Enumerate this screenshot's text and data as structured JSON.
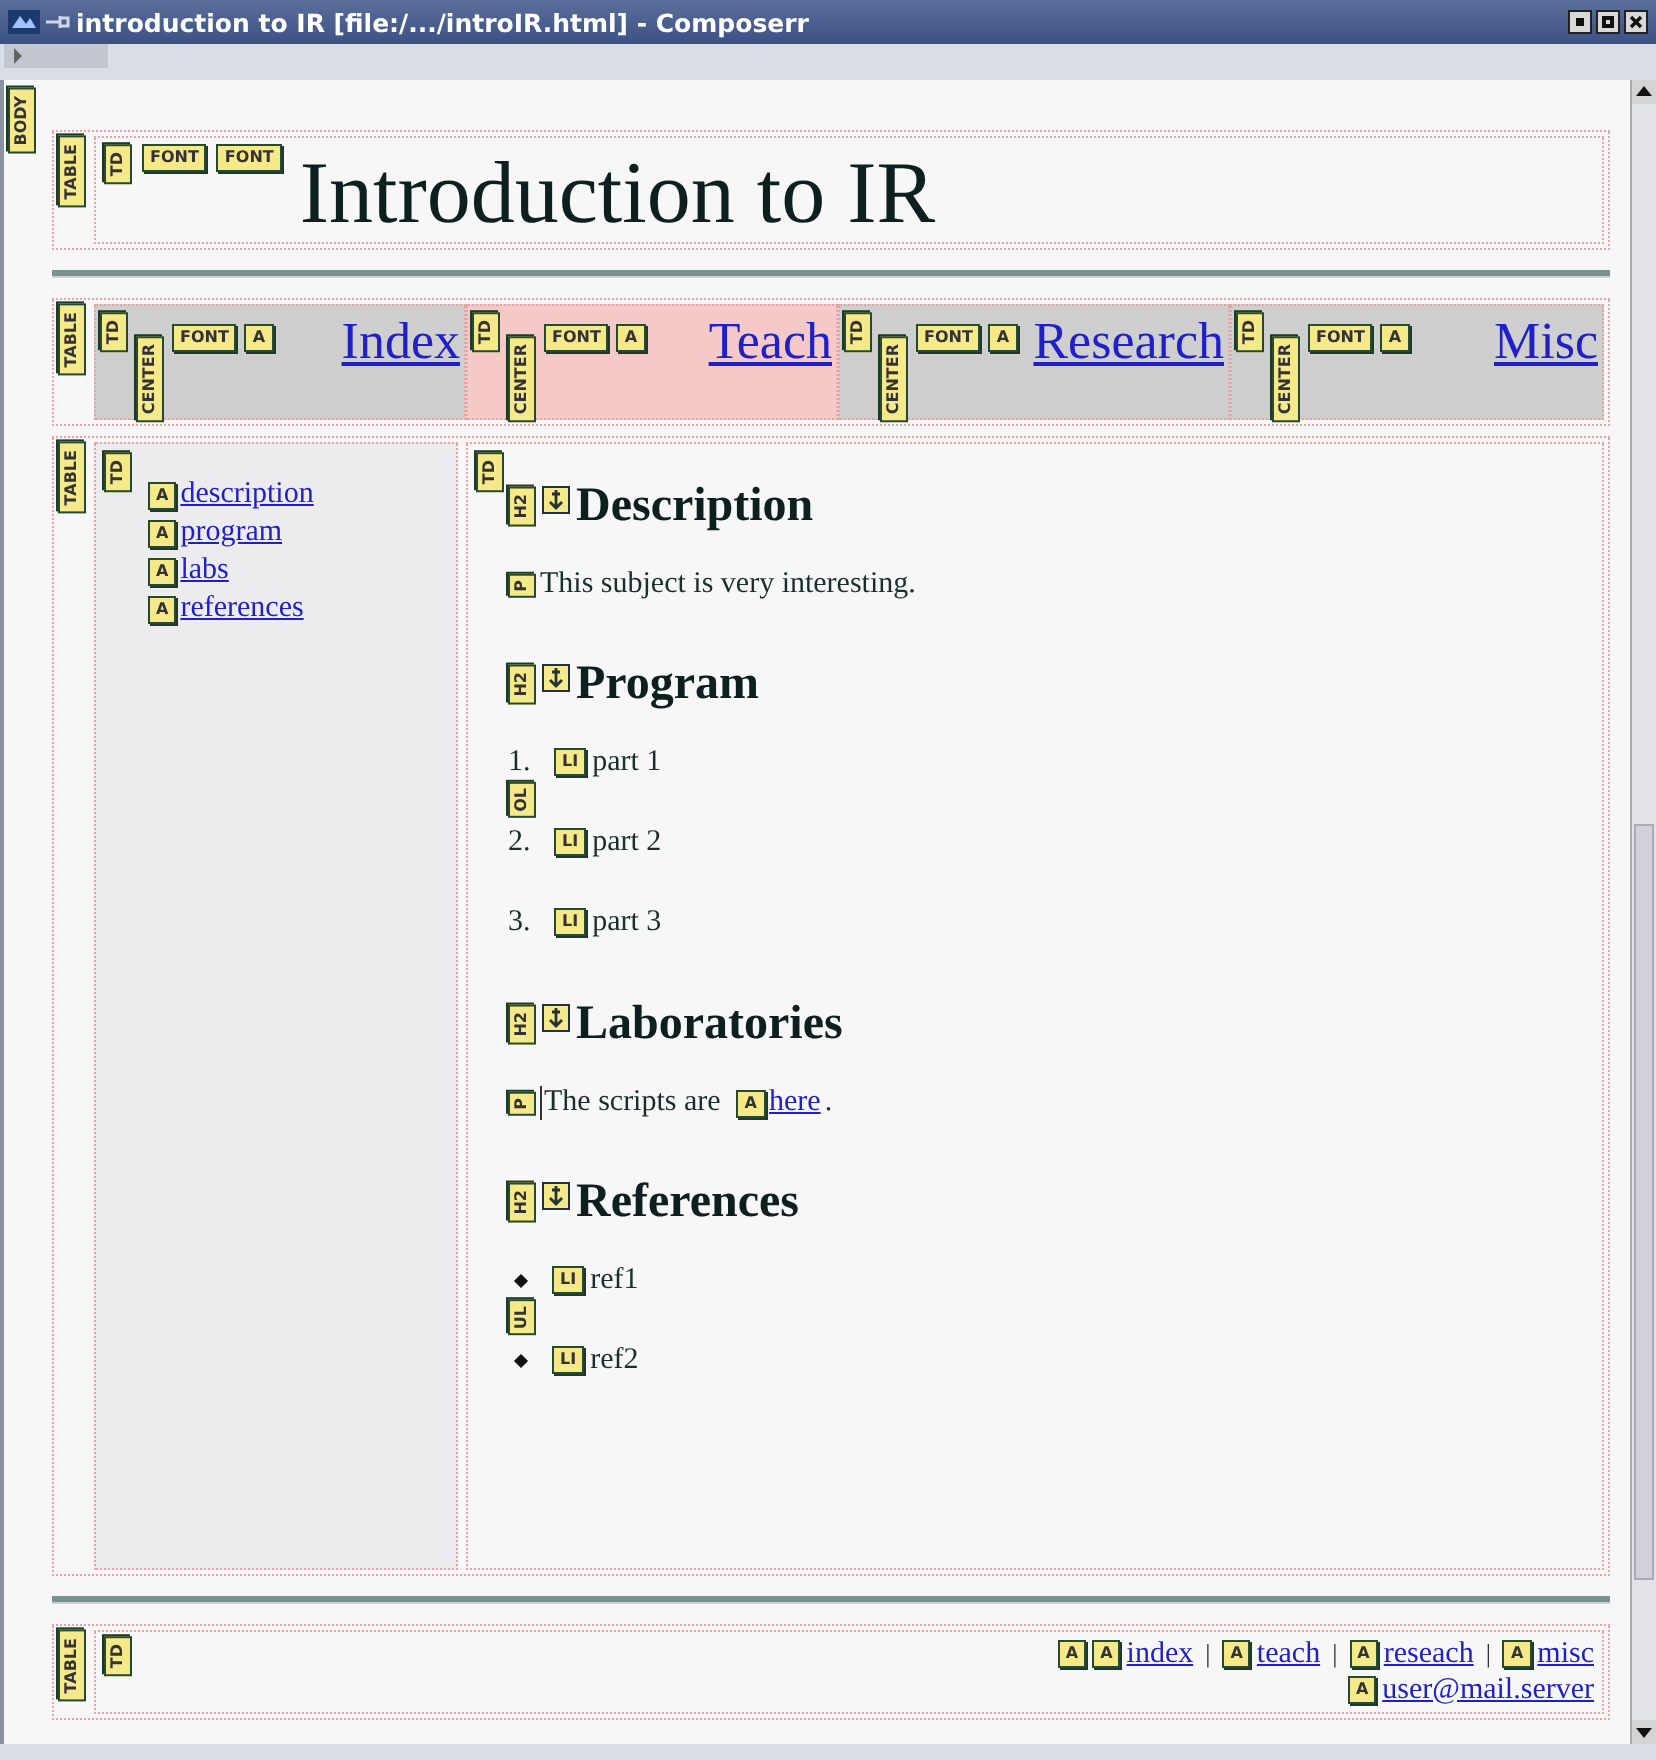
{
  "window": {
    "title": "introduction to IR [file:/.../introIR.html] - Composerr"
  },
  "body_tag": "BODY",
  "header": {
    "table_tag": "TABLE",
    "td_tag": "TD",
    "tags": [
      "FONT",
      "FONT"
    ],
    "title": "Introduction to IR"
  },
  "nav": {
    "table_tag": "TABLE",
    "cells": [
      {
        "td_tag": "TD",
        "center_tag": "CENTER",
        "tags": [
          "FONT",
          "A"
        ],
        "label": "Index",
        "selected": false
      },
      {
        "td_tag": "TD",
        "center_tag": "CENTER",
        "tags": [
          "FONT",
          "A"
        ],
        "label": "Teach",
        "selected": true
      },
      {
        "td_tag": "TD",
        "center_tag": "CENTER",
        "tags": [
          "FONT",
          "A"
        ],
        "label": "Research",
        "selected": false
      },
      {
        "td_tag": "TD",
        "center_tag": "CENTER",
        "tags": [
          "FONT",
          "A"
        ],
        "label": "Misc",
        "selected": false
      }
    ]
  },
  "main": {
    "table_tag": "TABLE",
    "sidebar": {
      "td_tag": "TD",
      "links": [
        {
          "tag": "A",
          "label": "description"
        },
        {
          "tag": "A",
          "label": "program"
        },
        {
          "tag": "A",
          "label": "labs"
        },
        {
          "tag": "A",
          "label": "references"
        }
      ]
    },
    "content": {
      "td_tag": "TD",
      "sections": [
        {
          "kind": "paragraph",
          "heading_tag": "H2",
          "heading": "Description",
          "p_tag": "P",
          "text": "This subject is very interesting."
        },
        {
          "kind": "ordered",
          "heading_tag": "H2",
          "heading": "Program",
          "list_tag": "OL",
          "items": [
            {
              "marker": "1.",
              "tag": "LI",
              "text": "part 1"
            },
            {
              "marker": "2.",
              "tag": "LI",
              "text": "part 2"
            },
            {
              "marker": "3.",
              "tag": "LI",
              "text": "part 3"
            }
          ]
        },
        {
          "kind": "link_paragraph",
          "heading_tag": "H2",
          "heading": "Laboratories",
          "p_tag": "P",
          "text": "The scripts are",
          "link_tag": "A",
          "link": "here",
          "after": "."
        },
        {
          "kind": "unordered",
          "heading_tag": "H2",
          "heading": "References",
          "list_tag": "UL",
          "items": [
            {
              "tag": "LI",
              "text": "ref1"
            },
            {
              "tag": "LI",
              "text": "ref2"
            }
          ]
        }
      ]
    }
  },
  "footer": {
    "table_tag": "TABLE",
    "td_tag": "TD",
    "lead_tag": "A",
    "links": [
      {
        "tag": "A",
        "label": "index",
        "separator": "|"
      },
      {
        "tag": "A",
        "label": "teach",
        "separator": "|"
      },
      {
        "tag": "A",
        "label": "reseach",
        "separator": "|"
      },
      {
        "tag": "A",
        "label": "misc"
      }
    ],
    "email": {
      "tag": "A",
      "label": "user@mail.server"
    }
  }
}
